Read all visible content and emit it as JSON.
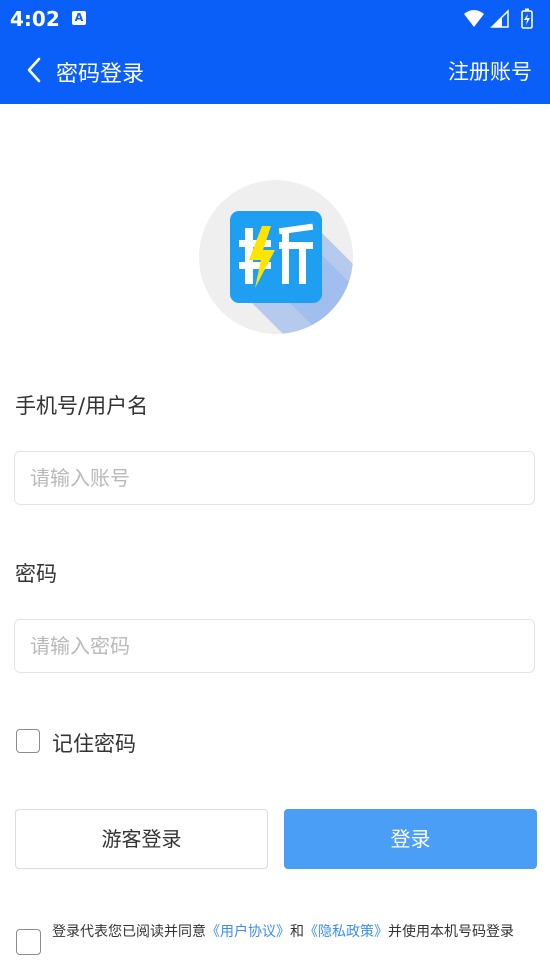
{
  "status_bar": {
    "time": "4:02",
    "notification_icon": "A",
    "icons": [
      "wifi-icon",
      "signal-icon",
      "battery-icon"
    ]
  },
  "header": {
    "back_icon": "chevron-left-icon",
    "title": "密码登录",
    "register_link": "注册账号"
  },
  "logo": {
    "glyph": "斩",
    "colors": {
      "tile": "#1e9ff2",
      "bolt": "#ffe400",
      "circle": "#efefef"
    }
  },
  "form": {
    "username": {
      "label": "手机号/用户名",
      "placeholder": "请输入账号",
      "value": ""
    },
    "password": {
      "label": "密码",
      "placeholder": "请输入密码",
      "value": ""
    },
    "remember": {
      "label": "记住密码",
      "checked": false
    }
  },
  "buttons": {
    "guest_login": "游客登录",
    "login": "登录"
  },
  "agreement": {
    "checked": false,
    "prefix": "登录代表您已阅读并同意",
    "user_agreement": "《用户协议》",
    "and": "和",
    "privacy_policy": "《隐私政策》",
    "suffix": "并使用本机号码登录"
  },
  "colors": {
    "header_bg": "#0a5ff8",
    "login_button": "#4a9ef6",
    "link": "#3a8ef3"
  }
}
